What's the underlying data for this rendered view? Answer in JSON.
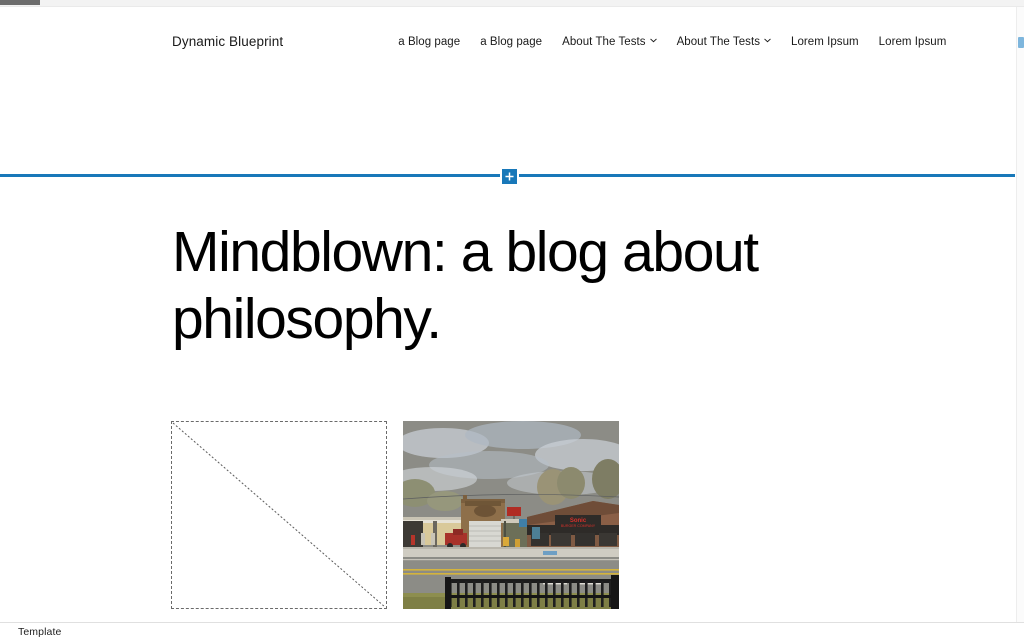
{
  "window": {
    "background_color": "#ffffff",
    "accent_color": "#1878b9"
  },
  "scrollbars": {
    "horizontal": {
      "thumb_label": "horizontal-scroll-thumb",
      "thumb_color": "#6d6d6d"
    },
    "vertical": {
      "thumb_label": "vertical-scroll-thumb",
      "thumb_color": "#7eb6dd"
    }
  },
  "site_header": {
    "site_title": "Dynamic Blueprint",
    "nav_items": [
      {
        "label": "a Blog page",
        "has_dropdown": false
      },
      {
        "label": "a Blog page",
        "has_dropdown": false
      },
      {
        "label": "About The Tests",
        "has_dropdown": true
      },
      {
        "label": "About The Tests",
        "has_dropdown": true
      },
      {
        "label": "Lorem Ipsum",
        "has_dropdown": false
      },
      {
        "label": "Lorem Ipsum",
        "has_dropdown": false
      }
    ]
  },
  "block_inserter": {
    "icon": "plus-icon",
    "tooltip": "Add block",
    "color": "#1878b9"
  },
  "page": {
    "heading": "Mindblown: a blog about philosophy.",
    "media": [
      {
        "type": "broken-image-placeholder",
        "alt": ""
      },
      {
        "type": "photo",
        "alt": "Street scene with storefronts, road and bench"
      }
    ]
  },
  "footer": {
    "breadcrumb": "Template"
  }
}
